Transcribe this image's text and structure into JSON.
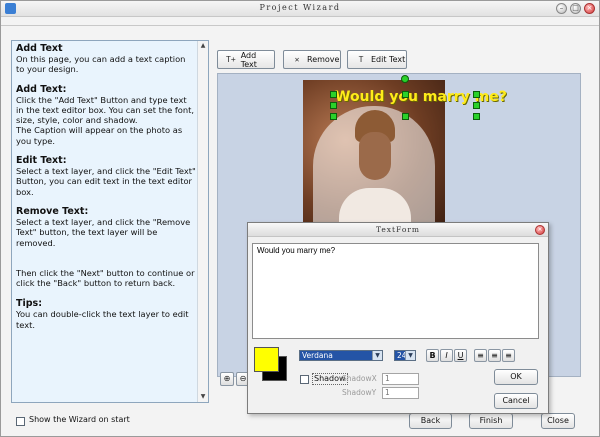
{
  "window": {
    "title": "Project Wizard",
    "controls": [
      "minimize",
      "maximize",
      "close"
    ]
  },
  "help": {
    "sections": [
      {
        "heading": "Add Text",
        "body": "On this page, you can add a text caption to your design."
      },
      {
        "heading": "Add Text:",
        "body": "Click the \"Add Text\" Button and type text in the text editor box. You can set the font, size, style, color and shadow.\nThe Caption will appear on the photo as you type."
      },
      {
        "heading": "Edit Text:",
        "body": "Select a text layer, and click the \"Edit Text\" Button, you can edit text in the text editor box."
      },
      {
        "heading": "Remove Text:",
        "body": "Select a text layer, and click the \"Remove Text\" button, the text layer will be removed."
      },
      {
        "heading": "",
        "body": "Then click the \"Next\" button to continue or click the \"Back\" button to return back."
      },
      {
        "heading": "Tips:",
        "body": "You can double-click the text layer to edit text."
      }
    ]
  },
  "toolbar": {
    "add_text": "Add Text",
    "remove": "Remove",
    "edit_text": "Edit Text"
  },
  "canvas": {
    "caption": "Would you marry me?",
    "caption_color": "#ffeb1a"
  },
  "footer": {
    "show_wizard_label": "Show the Wizard on start",
    "show_wizard_checked": false,
    "back": "Back",
    "finish": "Finish",
    "close": "Close"
  },
  "text_form": {
    "title": "TextForm",
    "text": "Would you marry me?",
    "foreground_color": "#ffff00",
    "background_color": "#000000",
    "font": "Verdana",
    "size": "24",
    "bold_label": "B",
    "italic_label": "I",
    "underline_label": "U",
    "shadow_label": "Shadow",
    "shadow_checked": false,
    "shadow_x_label": "ShadowX",
    "shadow_x_value": "1",
    "shadow_y_label": "ShadowY",
    "shadow_y_value": "1",
    "ok": "OK",
    "cancel": "Cancel"
  }
}
